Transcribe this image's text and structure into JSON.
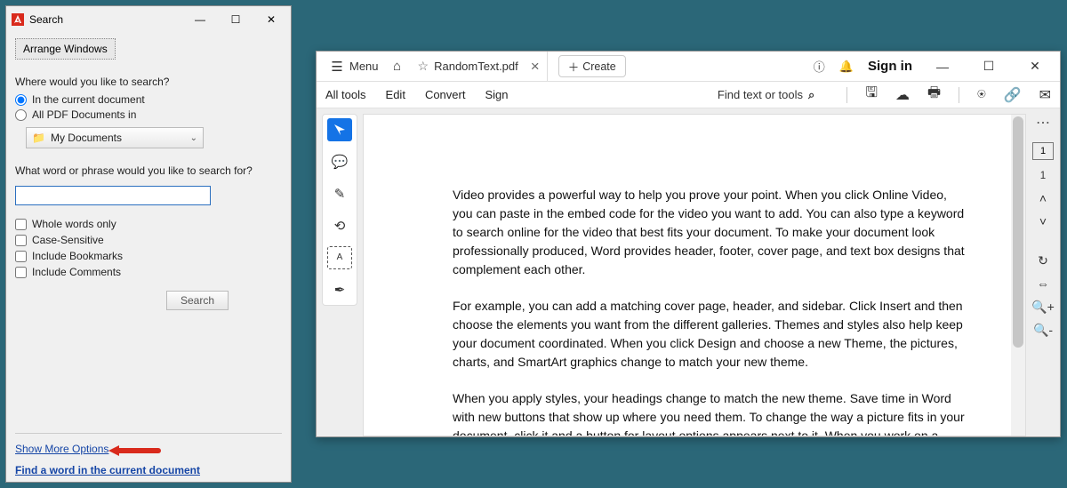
{
  "search_window": {
    "title": "Search",
    "arrange": "Arrange Windows",
    "where_label": "Where would you like to search?",
    "radio_current": "In the current document",
    "radio_all": "All PDF Documents in",
    "folder": "My Documents",
    "what_label": "What word or phrase would you like to search for?",
    "search_value": "",
    "chk_whole": "Whole words only",
    "chk_case": "Case-Sensitive",
    "chk_bookmarks": "Include Bookmarks",
    "chk_comments": "Include Comments",
    "btn_search": "Search",
    "link_more": "Show More Options",
    "link_find": "Find a word in the current document"
  },
  "pdf_window": {
    "menu_label": "Menu",
    "tab_title": "RandomText.pdf",
    "create_label": "Create",
    "sign_in": "Sign in",
    "subbar": {
      "all_tools": "All tools",
      "edit": "Edit",
      "convert": "Convert",
      "sign": "Sign",
      "find": "Find text or tools"
    },
    "page_current": "1",
    "page_total": "1",
    "document": {
      "p1": "Video provides a powerful way to help you prove your point. When you click Online Video, you can paste in the embed code for the video you want to add. You can also type a keyword to search online for the video that best fits your document. To make your document look professionally produced, Word provides header, footer, cover page, and text box designs that complement each other.",
      "p2": "For example, you can add a matching cover page, header, and sidebar. Click Insert and then choose the elements you want from the different galleries. Themes and styles also help keep your document coordinated. When you click Design and choose a new Theme, the pictures, charts, and SmartArt graphics change to match your new theme.",
      "p3": "When you apply styles, your headings change to match the new theme. Save time in Word with new buttons that show up where you need them. To change the way a picture fits in your document, click it and a button for layout options appears next to it. When you work on a table, click where you want to add a row or a column, and then click the plus sign."
    }
  }
}
